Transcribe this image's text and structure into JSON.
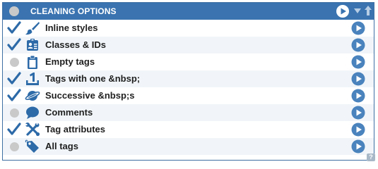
{
  "panel": {
    "title": "CLEANING OPTIONS",
    "help_label": "?"
  },
  "colors": {
    "header_bg": "#3a73b0",
    "accent": "#3471ad",
    "play_blue": "#4a83bd",
    "row_alt": "#f1f5f9",
    "inactive_dot": "#c9c9c9"
  },
  "options": [
    {
      "label": "Inline styles",
      "enabled": true,
      "icon": "paintbrush-icon"
    },
    {
      "label": "Classes & IDs",
      "enabled": true,
      "icon": "id-card-icon"
    },
    {
      "label": "Empty tags",
      "enabled": false,
      "icon": "clipboard-icon"
    },
    {
      "label": "Tags with one &nbsp;",
      "enabled": true,
      "icon": "number-one-icon"
    },
    {
      "label": "Successive &nbsp;s",
      "enabled": true,
      "icon": "planet-icon"
    },
    {
      "label": "Comments",
      "enabled": false,
      "icon": "speech-bubble-icon"
    },
    {
      "label": "Tag attributes",
      "enabled": true,
      "icon": "tools-icon"
    },
    {
      "label": "All tags",
      "enabled": false,
      "icon": "tag-icon"
    }
  ]
}
